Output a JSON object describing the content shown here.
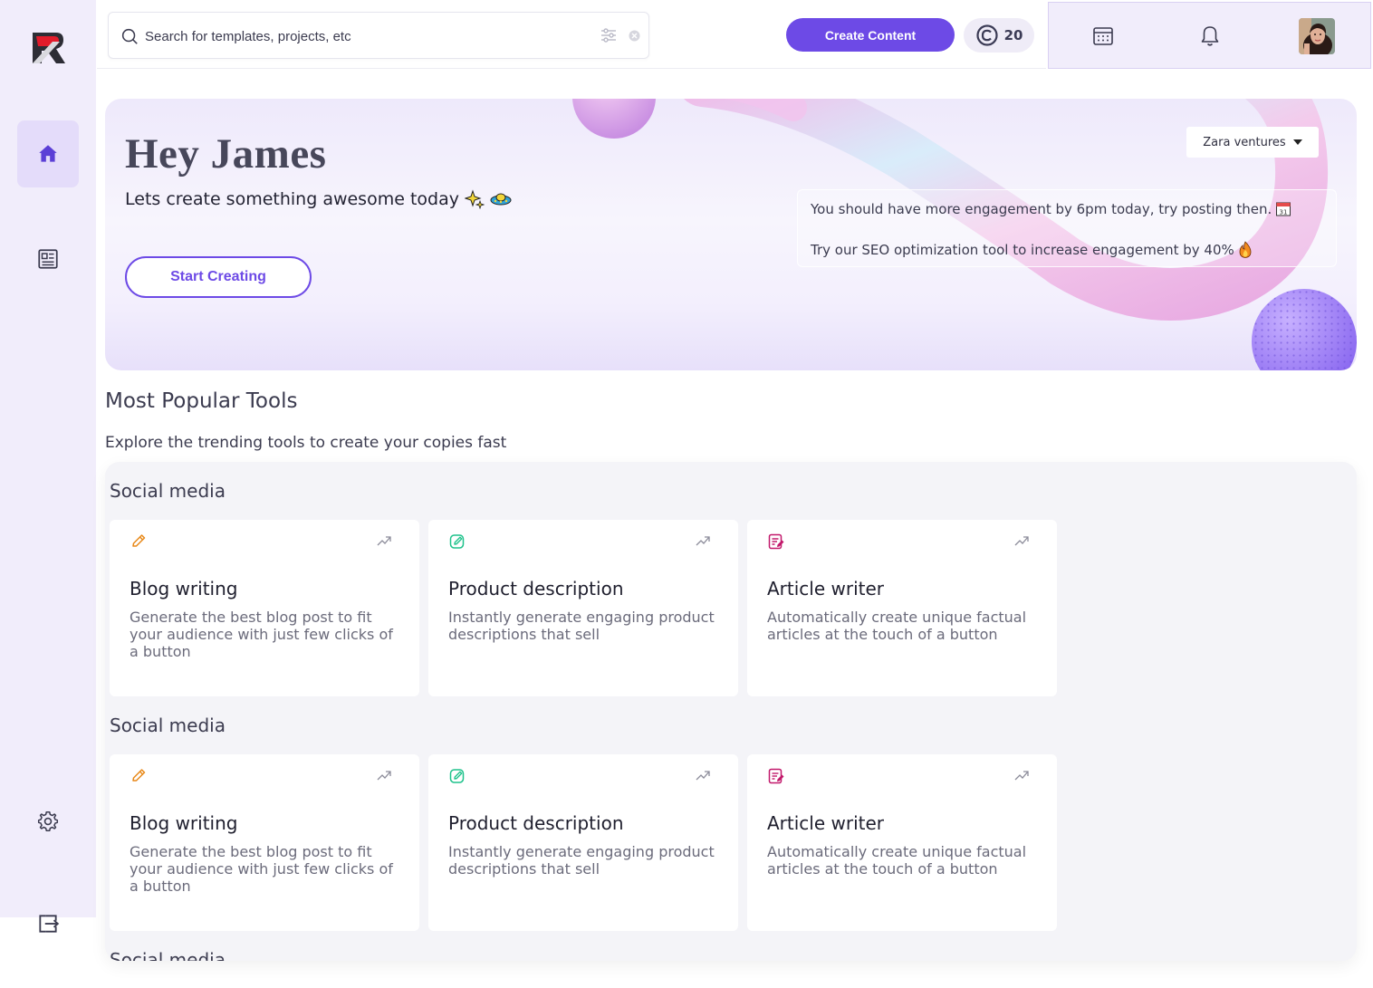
{
  "search": {
    "placeholder": "Search for templates, projects, etc"
  },
  "topbar": {
    "create_label": "Create Content",
    "credits": "20"
  },
  "hero": {
    "greeting": "Hey James",
    "subtitle": "Lets create something awesome today",
    "cta": "Start Creating",
    "workspace": "Zara ventures",
    "tips": [
      "You should have more engagement by 6pm today, try posting then.",
      "Try our SEO optimization tool to increase engagement by 40%"
    ]
  },
  "tools": {
    "title": "Most Popular Tools",
    "subtitle": "Explore the trending tools to create your copies fast",
    "categories": [
      {
        "name": "Social media",
        "cards": [
          {
            "title": "Blog writing",
            "desc": "Generate the best blog post to fit your audience with just few clicks of a button",
            "icon": "pencil-icon"
          },
          {
            "title": "Product description",
            "desc": "Instantly generate engaging product descriptions that sell",
            "icon": "edit-square-icon"
          },
          {
            "title": "Article writer",
            "desc": "Automatically create unique factual articles at the touch of a button",
            "icon": "document-edit-icon"
          }
        ]
      },
      {
        "name": "Social media",
        "cards": [
          {
            "title": "Blog writing",
            "desc": "Generate the best blog post to fit your audience with just few clicks of a button",
            "icon": "pencil-icon"
          },
          {
            "title": "Product description",
            "desc": "Instantly generate engaging product descriptions that sell",
            "icon": "edit-square-icon"
          },
          {
            "title": "Article writer",
            "desc": "Automatically create unique factual articles at the touch of a button",
            "icon": "document-edit-icon"
          }
        ]
      },
      {
        "name": "Social media",
        "cards": []
      }
    ]
  },
  "colors": {
    "accent": "#6d4ae6",
    "sidebar_bg": "#f1edfb",
    "orange_icon": "#e8891a",
    "teal_icon": "#1ec28b",
    "pink_icon": "#c2186b"
  }
}
